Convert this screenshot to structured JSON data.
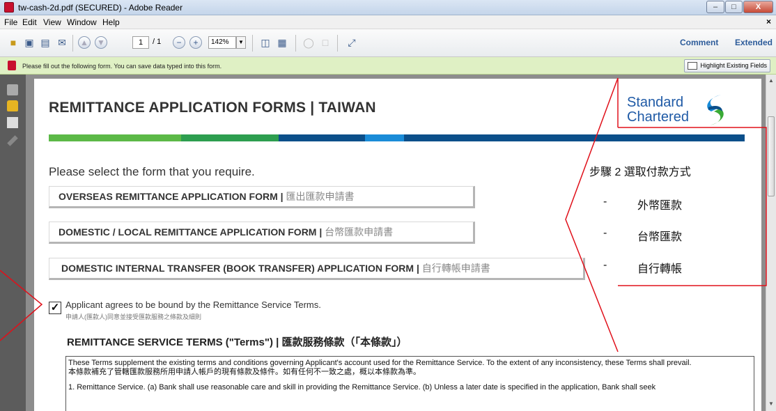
{
  "window": {
    "title": "tw-cash-2d.pdf (SECURED) - Adobe Reader",
    "min_glyph": "–",
    "max_glyph": "□",
    "close_glyph": "X"
  },
  "menu": {
    "items": [
      {
        "label": "File"
      },
      {
        "label": "Edit"
      },
      {
        "label": "View"
      },
      {
        "label": "Window"
      },
      {
        "label": "Help"
      }
    ],
    "close_glyph": "×"
  },
  "toolbar": {
    "page_current": "1",
    "page_total": "/ 1",
    "zoom": "142%",
    "comment_label": "Comment",
    "extended_label": "Extended"
  },
  "infobar": {
    "message": "Please fill out the following form. You can save data typed into this form.",
    "highlight_label": "Highlight Existing Fields"
  },
  "doc": {
    "title": "REMITTANCE APPLICATION  FORMS  |  TAIWAN",
    "logo_line1": "Standard",
    "logo_line2": "Chartered",
    "select_prompt": "Please select the form that you require.",
    "forms": [
      {
        "en": "OVERSEAS REMITTANCE  APPLICATION  FORM |",
        "zh": " 匯出匯款申請書"
      },
      {
        "en": "DOMESTIC / LOCAL REMITTANCE  APPLICATION  FORM |",
        "zh": " 台幣匯款申請書"
      },
      {
        "en": "DOMESTIC INTERNAL TRANSFER (BOOK TRANSFER) APPLICATION FORM |",
        "zh": " 自行轉帳申請書"
      }
    ],
    "agree_checked": "✓",
    "agree_en": "Applicant agrees to be bound by the Remittance Service Terms.",
    "agree_zh": "申請人(匯款人)同意並接受匯款服務之條款及細則",
    "terms_heading_pre": "REMITTANCE SERVICE TERMS (\"",
    "terms_heading_bold": "Terms",
    "terms_heading_post": "\") | 匯款服務條款（「本條款」）",
    "terms_line1": "These Terms supplement the existing terms and conditions governing Applicant's account used for the Remittance Service. To the extent of any inconsistency, these Terms shall prevail.",
    "terms_line2": "本條款補充了管轄匯款服務所用申請人帳戶的現有條款及條件。如有任何不一致之處，概以本條款為準。",
    "terms_line3": "1. Remittance Service. (a) Bank shall use reasonable care and skill in providing the Remittance Service. (b) Unless a later date is specified in the application, Bank shall seek"
  },
  "callout": {
    "heading": "步驟 2  選取付款方式",
    "items": [
      {
        "dash": "-",
        "text": "外幣匯款"
      },
      {
        "dash": "-",
        "text": "台幣匯款"
      },
      {
        "dash": "-",
        "text": "自行轉帳"
      }
    ]
  },
  "colors": {
    "stripe_green_light": "#5cb947",
    "stripe_green_dark": "#2d9e4f",
    "stripe_blue_dark": "#0b4f8a",
    "stripe_blue_light": "#1a8cd8",
    "annotation_red": "#e0101a",
    "logo_blue": "#1f5aa6",
    "logo_green": "#3aaa35"
  }
}
